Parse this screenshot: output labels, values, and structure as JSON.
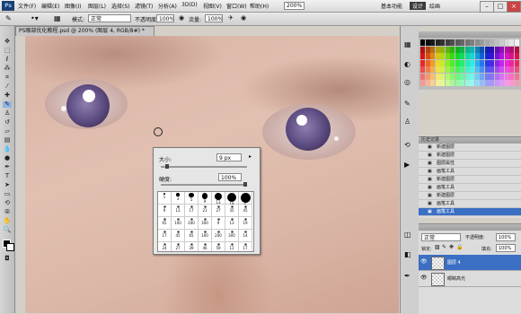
{
  "menu": [
    "文件(F)",
    "编辑(E)",
    "图像(I)",
    "图层(L)",
    "选择(S)",
    "滤镜(T)",
    "分析(A)",
    "3D(D)",
    "视图(V)",
    "窗口(W)",
    "帮助(H)"
  ],
  "menu_right": {
    "zoom": "200%",
    "workspace": "基本功能",
    "mode1": "设计",
    "mode2": "绘画"
  },
  "options": {
    "mode_label": "模式:",
    "mode_value": "正常",
    "opacity_label": "不透明度:",
    "opacity_value": "100%",
    "flow_label": "流量:",
    "flow_value": "100%"
  },
  "document_tab": "PS眼部优化教程.psd @ 200% (图层 4, RGB/8#) *",
  "brush_popup": {
    "size_label": "大小:",
    "size_value": "9 px",
    "hardness_label": "硬度:",
    "hardness_value": "100%",
    "size_slider_level": 0.05,
    "hardness_slider_level": 1.0,
    "brush_numbers": [
      "1",
      "3",
      "5",
      "9",
      "13",
      "19",
      "5",
      "9",
      "13",
      "17",
      "21",
      "27",
      "35",
      "45",
      "65",
      "100",
      "200",
      "300",
      "9",
      "13",
      "19",
      "17",
      "45",
      "65",
      "100",
      "200",
      "300",
      "14",
      "24",
      "27",
      "39",
      "46",
      "59",
      "11",
      "17",
      "23"
    ]
  },
  "history": {
    "title": "历史记录",
    "items": [
      "新建图层",
      "新建图层",
      "图层属性",
      "画笔工具",
      "新建图层",
      "画笔工具",
      "新建图层",
      "画笔工具",
      "画笔工具"
    ],
    "selected_index": 8
  },
  "layers": {
    "blend_mode": "正常",
    "opacity_label": "不透明度:",
    "opacity_value": "100%",
    "lock_label": "锁定:",
    "fill_label": "填充:",
    "fill_value": "100%",
    "items": [
      {
        "name": "图层 4",
        "selected": true
      },
      {
        "name": "眼睛高光",
        "selected": false
      }
    ]
  },
  "colors": {
    "accent": "#3a6fc4",
    "iris": "#5b4a80",
    "skin": "#dcb7a8"
  }
}
